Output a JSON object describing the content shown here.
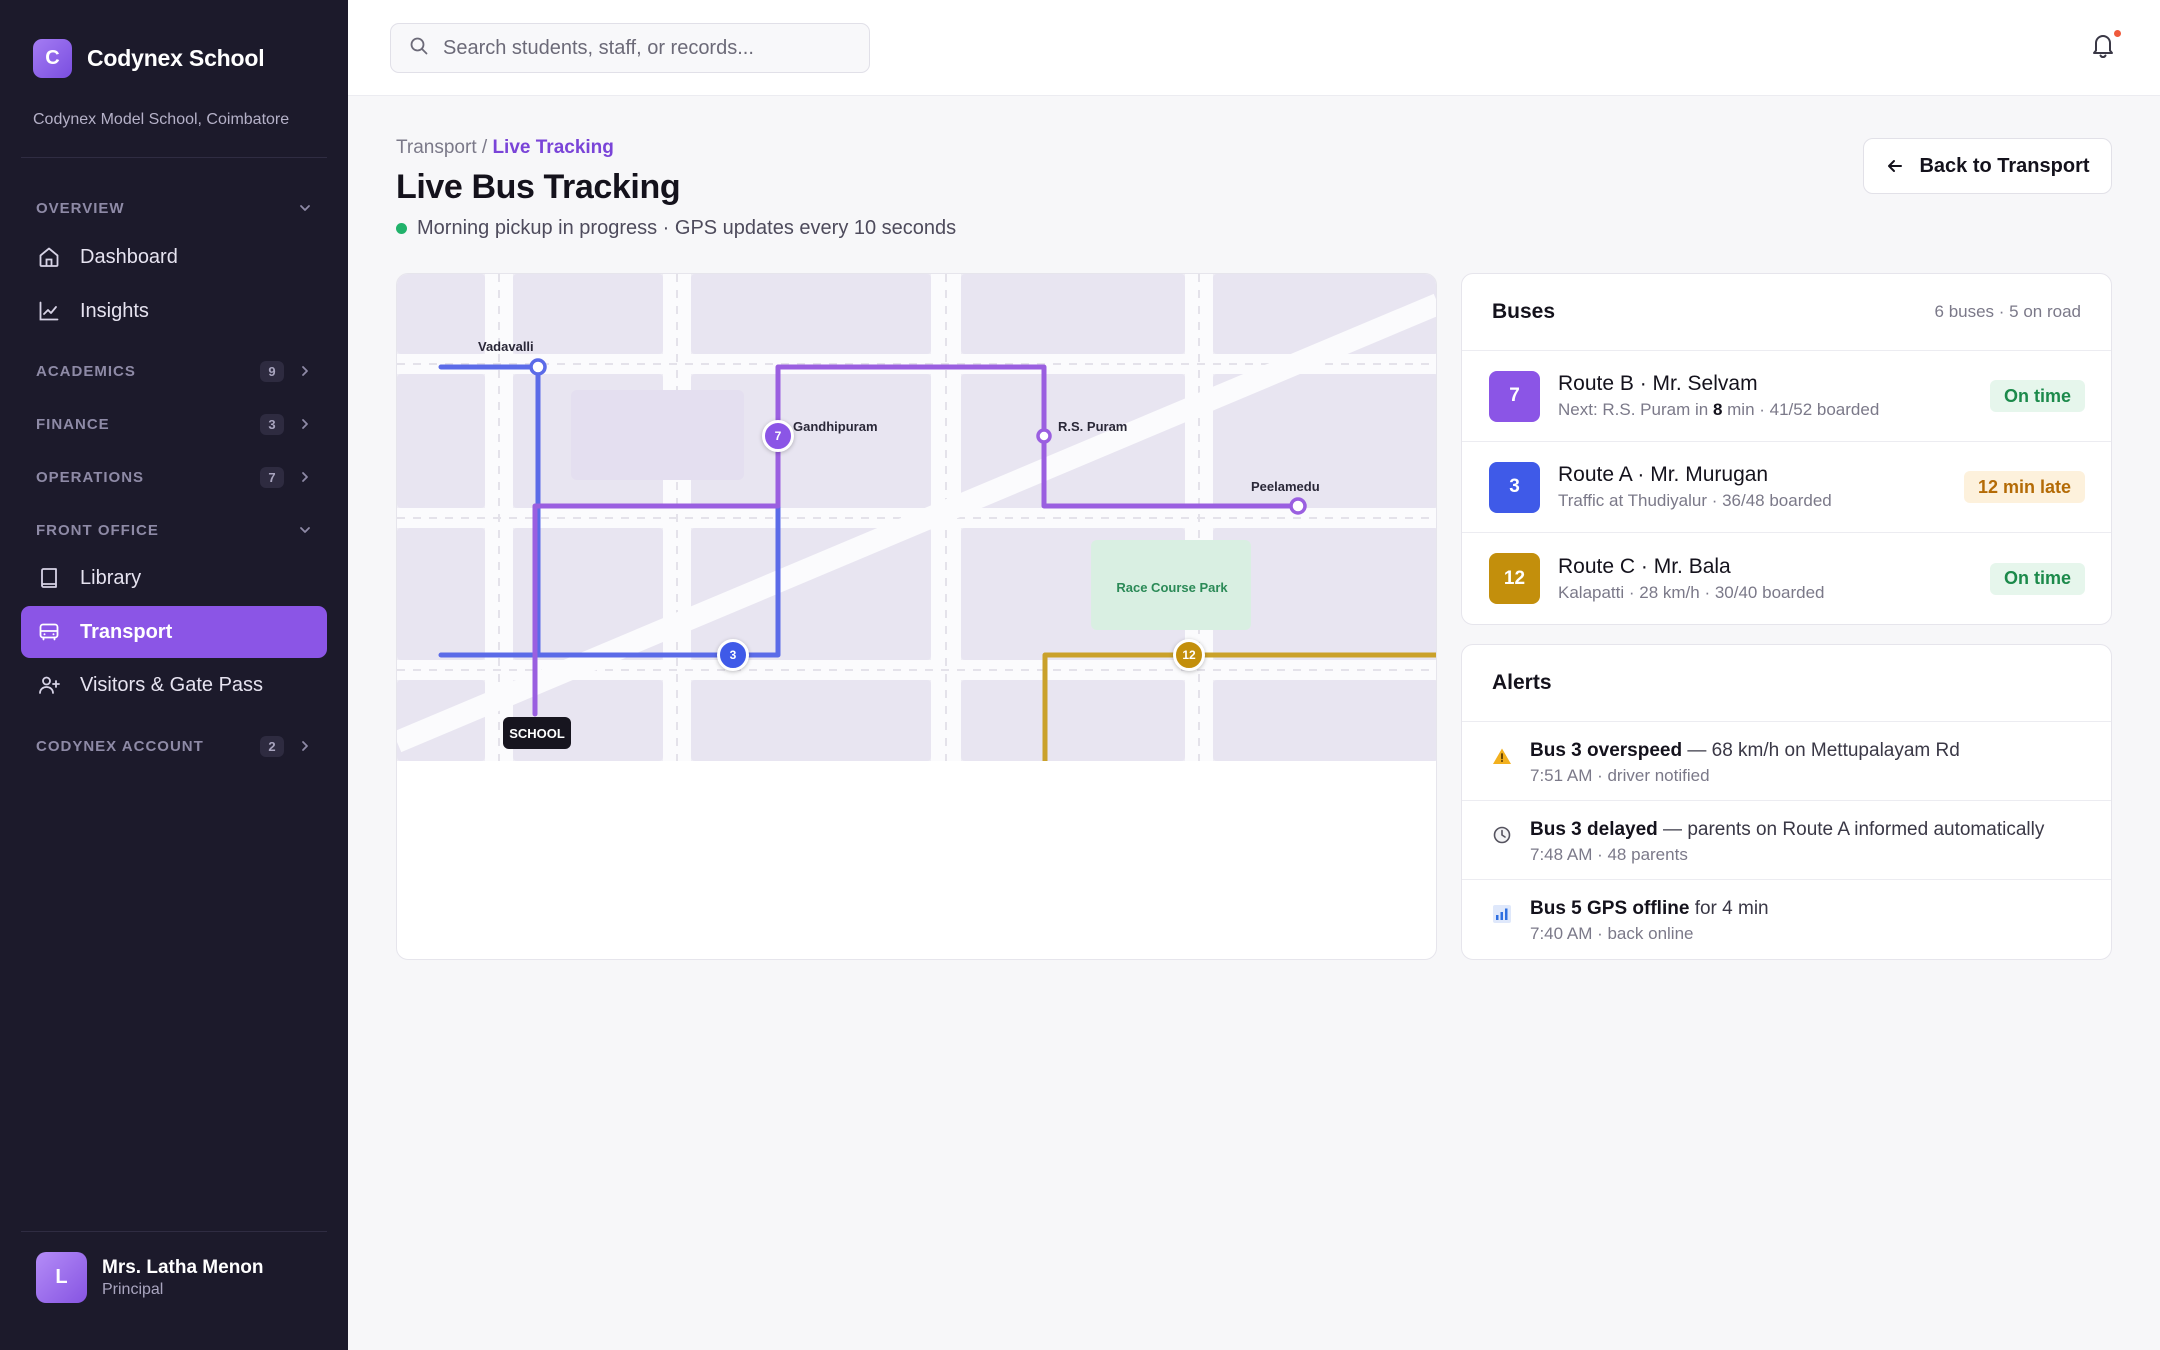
{
  "brand": {
    "logo_letter": "C",
    "name": "Codynex School",
    "subtitle": "Codynex Model School, Coimbatore"
  },
  "sidebar": {
    "sections": [
      {
        "label": "OVERVIEW",
        "badge": null,
        "expanded": true
      },
      {
        "label": "ACADEMICS",
        "badge": "9",
        "expanded": false
      },
      {
        "label": "FINANCE",
        "badge": "3",
        "expanded": false
      },
      {
        "label": "OPERATIONS",
        "badge": "7",
        "expanded": false
      },
      {
        "label": "FRONT OFFICE",
        "badge": null,
        "expanded": true
      },
      {
        "label": "CODYNEX ACCOUNT",
        "badge": "2",
        "expanded": false
      }
    ],
    "items": [
      {
        "label": "Dashboard",
        "icon": "home-icon"
      },
      {
        "label": "Insights",
        "icon": "chart-line-icon"
      },
      {
        "label": "Library",
        "icon": "book-icon"
      },
      {
        "label": "Transport",
        "icon": "bus-icon",
        "active": true
      },
      {
        "label": "Visitors & Gate Pass",
        "icon": "user-plus-icon"
      }
    ],
    "user": {
      "initial": "L",
      "name": "Mrs. Latha Menon",
      "role": "Principal"
    }
  },
  "topbar": {
    "search_placeholder": "Search students, staff, or records...",
    "has_notification": true
  },
  "header": {
    "breadcrumb_parent": "Transport",
    "breadcrumb_sep": " / ",
    "breadcrumb_current": "Live Tracking",
    "title": "Live Bus Tracking",
    "status": "Morning pickup in progress · GPS updates every 10 seconds",
    "back_label": "Back to Transport"
  },
  "map": {
    "labels": {
      "vadavalli": "Vadavalli",
      "gandhipuram": "Gandhipuram",
      "rs_puram": "R.S. Puram",
      "peelamedu": "Peelamedu",
      "school": "SCHOOL",
      "park": "Race Course Park"
    },
    "markers": {
      "bus7": "7",
      "bus3": "3",
      "bus12": "12"
    },
    "colors": {
      "route_a": "#5b6be8",
      "route_b": "#9a5fe0",
      "route_c": "#caa12a"
    }
  },
  "buses": {
    "title": "Buses",
    "meta": "6 buses · 5 on road",
    "items": [
      {
        "num": "7",
        "color": "#8b55e6",
        "name": "Route B · Mr. Selvam",
        "sub_pre": "Next: R.S. Puram in ",
        "sub_bold": "8",
        "sub_post": " min · 41/52 boarded",
        "status": "On time",
        "status_kind": "ok"
      },
      {
        "num": "3",
        "color": "#3f5ae8",
        "name": "Route A · Mr. Murugan",
        "sub_pre": "Traffic at Thudiyalur · 36/48 boarded",
        "sub_bold": "",
        "sub_post": "",
        "status": "12 min late",
        "status_kind": "late"
      },
      {
        "num": "12",
        "color": "#c38f0c",
        "name": "Route C · Mr. Bala",
        "sub_pre": "Kalapatti · 28 km/h · 30/40 boarded",
        "sub_bold": "",
        "sub_post": "",
        "status": "On time",
        "status_kind": "ok"
      }
    ]
  },
  "alerts": {
    "title": "Alerts",
    "items": [
      {
        "icon": "warning-icon",
        "bold": "Bus 3 overspeed",
        "rest": " — 68 km/h on Mettupalayam Rd",
        "sub": "7:51 AM · driver notified"
      },
      {
        "icon": "clock-icon",
        "bold": "Bus 3 delayed",
        "rest": " — parents on Route A informed automatically",
        "sub": "7:48 AM · 48 parents"
      },
      {
        "icon": "signal-icon",
        "bold": "Bus 5 GPS offline",
        "rest": " for 4 min",
        "sub": "7:40 AM · back online"
      }
    ]
  }
}
